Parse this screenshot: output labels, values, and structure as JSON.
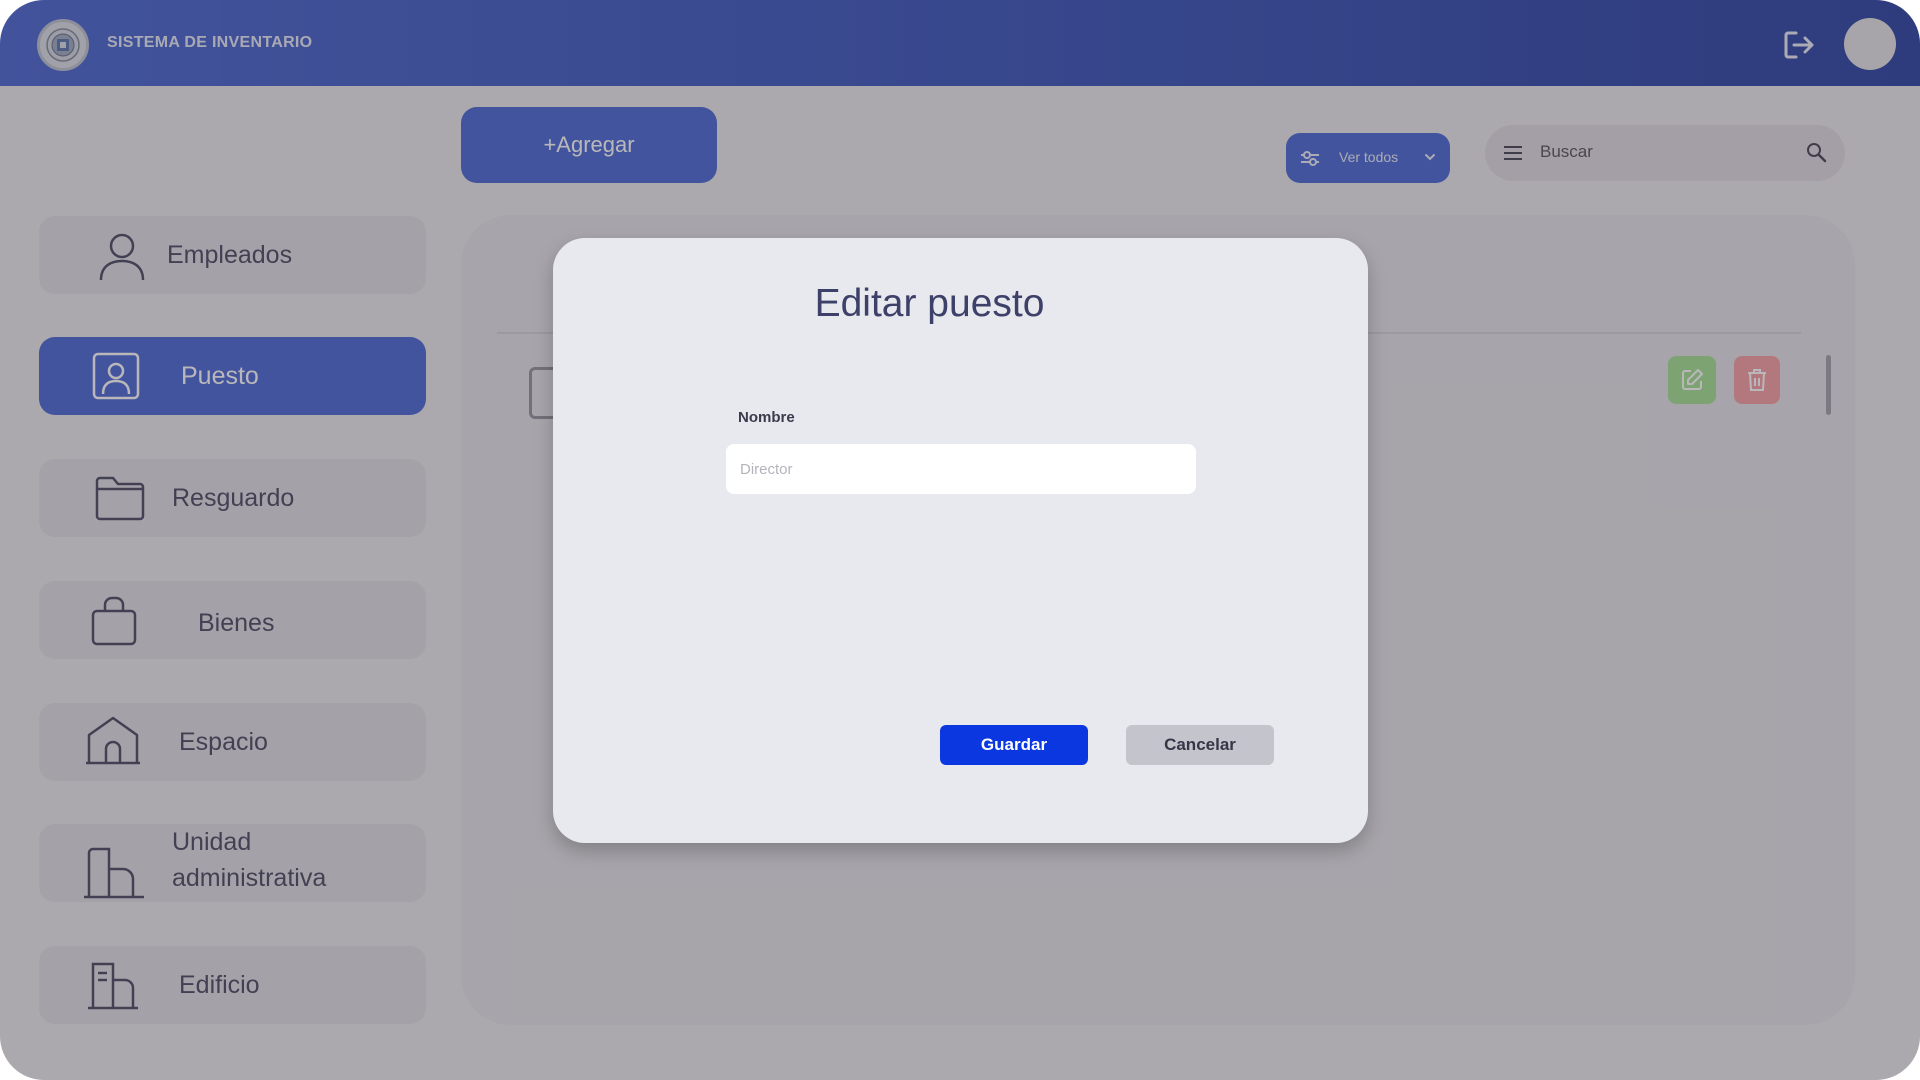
{
  "header": {
    "app_title": "SISTEMA DE INVENTARIO",
    "logo_icon": "seal-logo",
    "logout_icon": "logout-icon"
  },
  "toolbar": {
    "add_label": "+Agregar",
    "filter_label": "Ver todos",
    "search_placeholder": "Buscar"
  },
  "sidebar": {
    "items": [
      {
        "label": "Empleados",
        "icon": "user-icon",
        "active": false
      },
      {
        "label": "Puesto",
        "icon": "id-badge-icon",
        "active": true
      },
      {
        "label": "Resguardo",
        "icon": "folder-icon",
        "active": false
      },
      {
        "label": "Bienes",
        "icon": "briefcase-icon",
        "active": false
      },
      {
        "label": "Espacio",
        "icon": "house-icon",
        "active": false
      },
      {
        "label": "Unidad administrativa",
        "icon": "buildings-icon",
        "active": false
      },
      {
        "label": "Edificio",
        "icon": "building-icon",
        "active": false
      }
    ]
  },
  "modal": {
    "title": "Editar puesto",
    "field_label": "Nombre",
    "field_placeholder": "Director",
    "field_value": "",
    "save_label": "Guardar",
    "cancel_label": "Cancelar"
  },
  "colors": {
    "primary": "#3f5fd3",
    "save": "#0b37e0",
    "edit": "#9fdf8f",
    "delete": "#f59aa0"
  }
}
